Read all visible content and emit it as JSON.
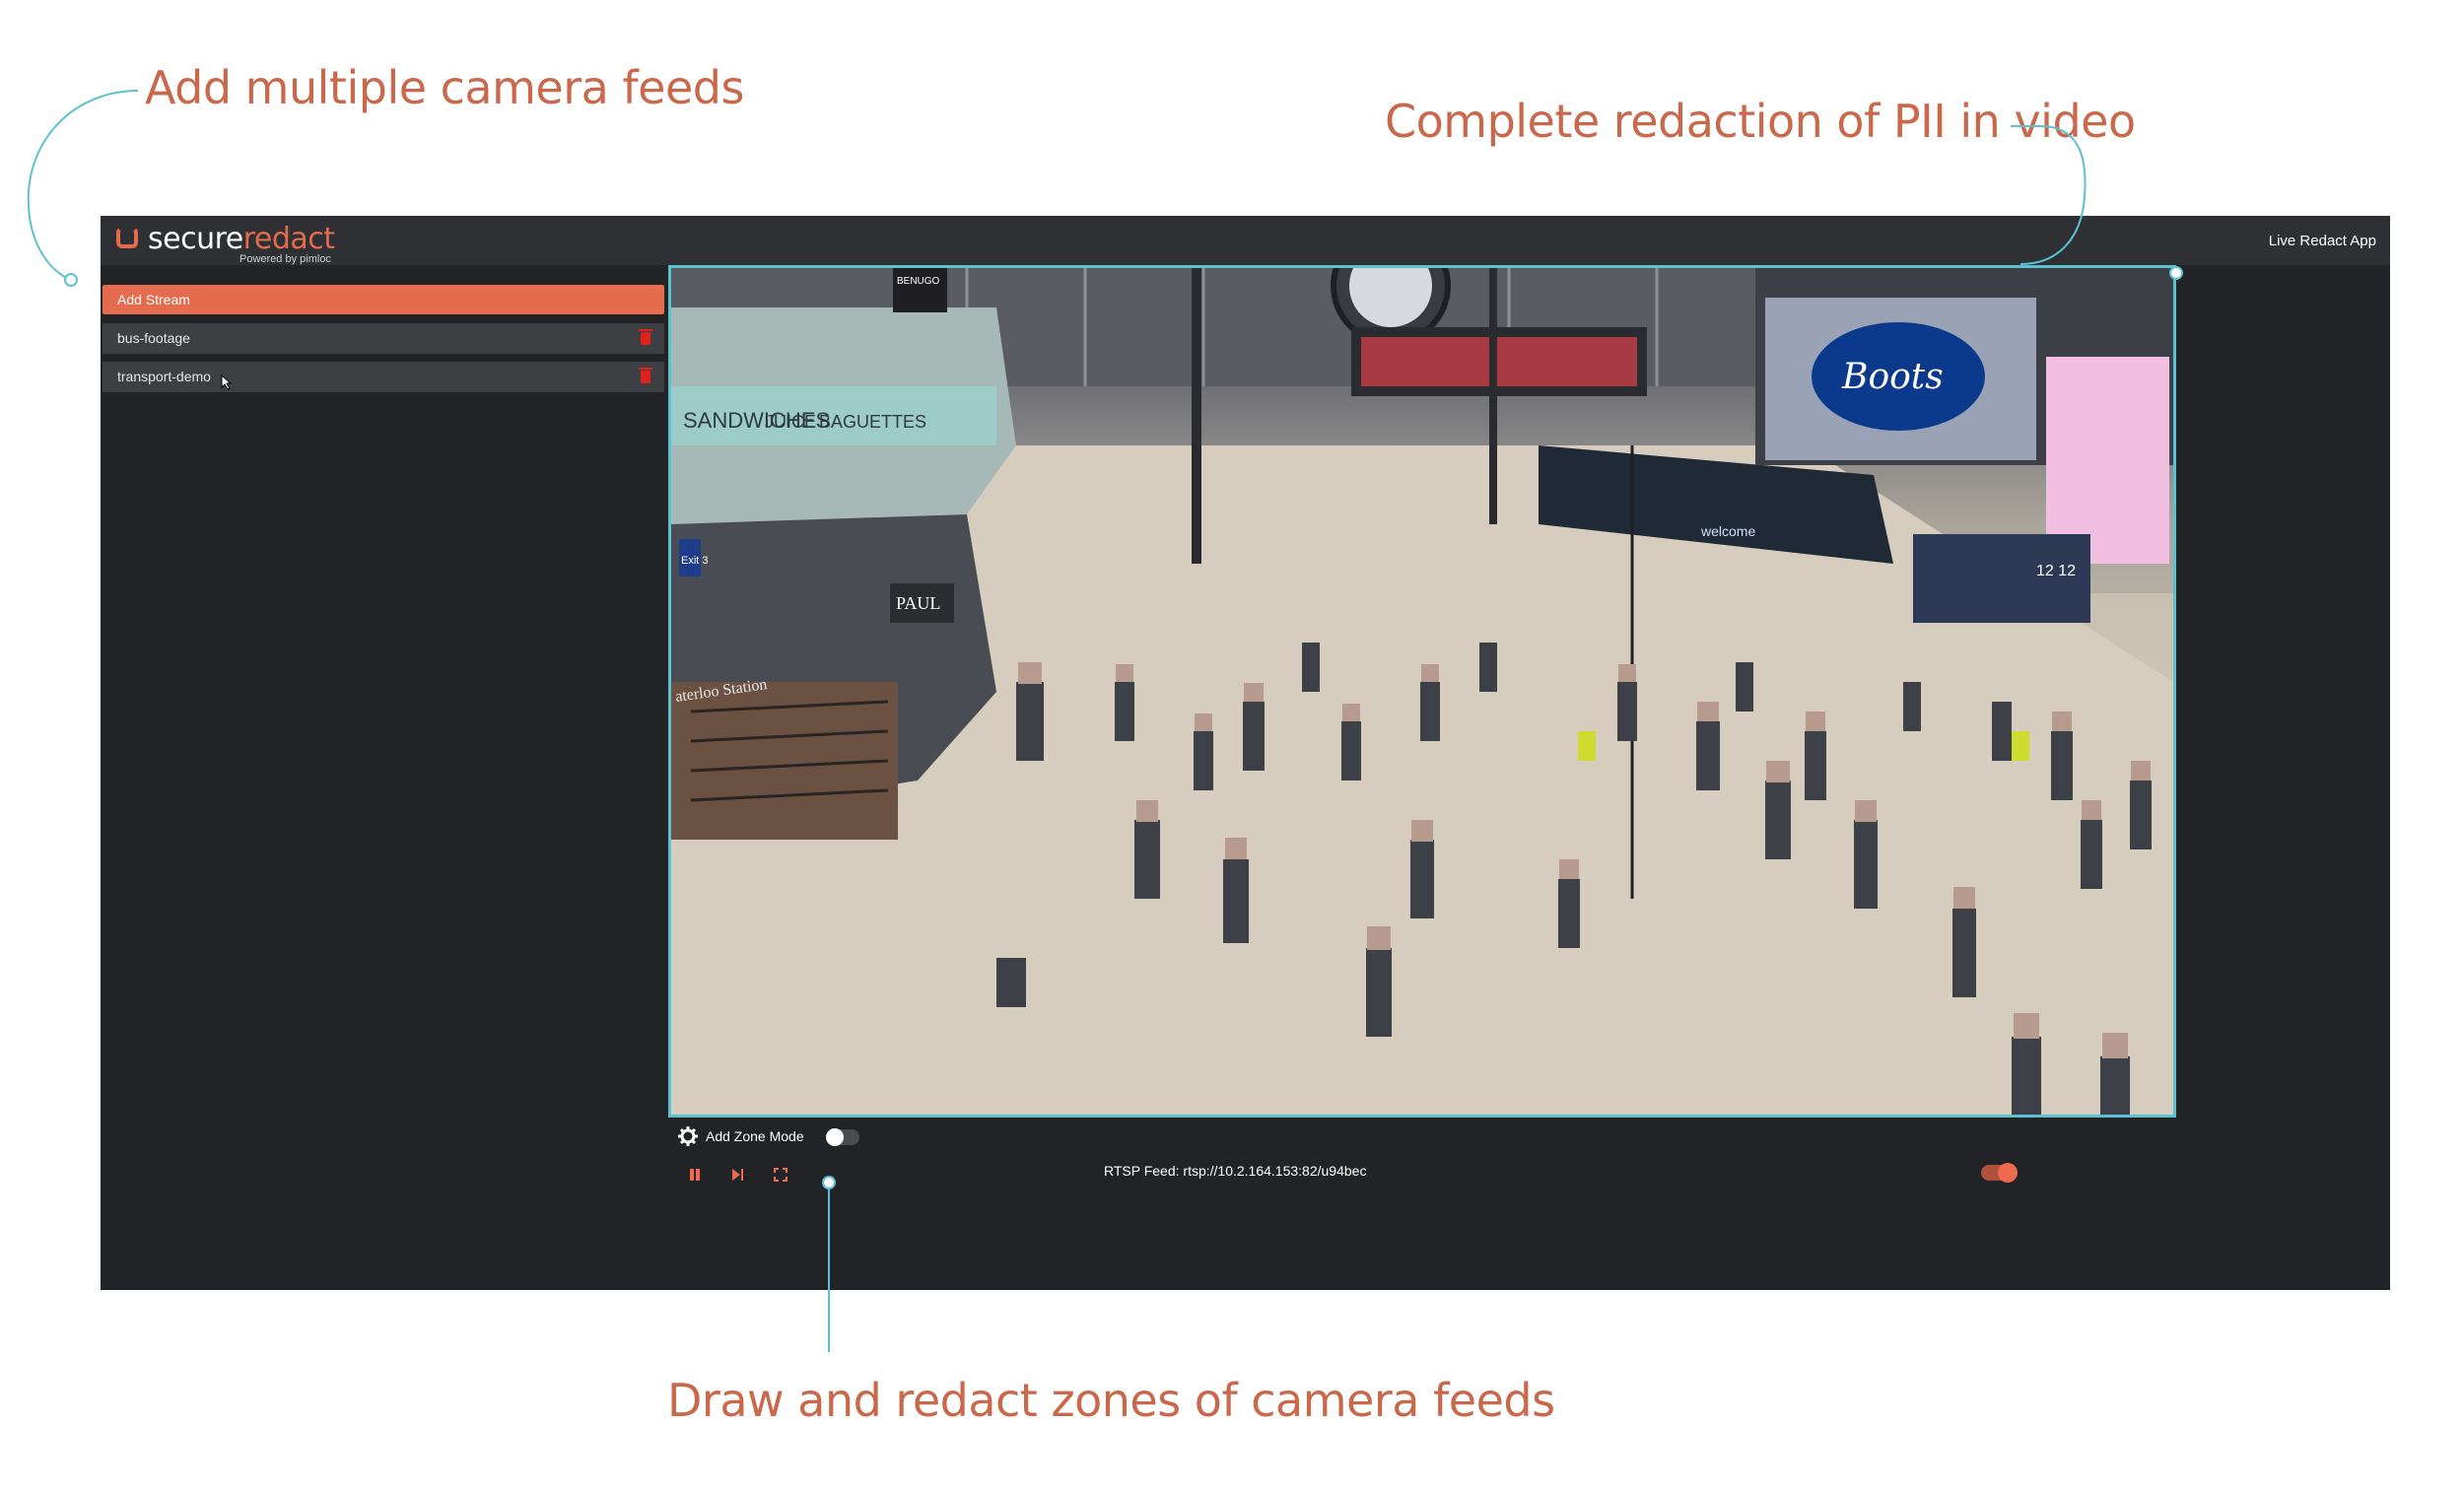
{
  "callouts": {
    "multiple_feeds": "Add multiple camera feeds",
    "redaction": "Complete redaction of PII in video",
    "zones": "Draw and redact zones of camera feeds"
  },
  "header": {
    "logo_secure": "secure",
    "logo_redact": "redact",
    "logo_sub": "Powered by pimloc",
    "app_title": "Live Redact App"
  },
  "sidebar": {
    "add_stream_label": "Add Stream",
    "streams": [
      {
        "label": "bus-footage"
      },
      {
        "label": "transport-demo"
      }
    ]
  },
  "video": {
    "signage": [
      "SANDWICHES",
      "JUICE",
      "BAGUETTES",
      "Boots",
      "Exit 3",
      "welcome",
      "12 12",
      "BENUGO",
      "PAUL",
      "aterloo Station"
    ]
  },
  "controls": {
    "add_zone_mode_label": "Add Zone Mode",
    "add_zone_mode_on": false,
    "rtsp_label": "RTSP Feed: rtsp://10.2.164.153:82/u94bec",
    "rtsp_toggle_on": true
  },
  "colors": {
    "accent": "#e56b4e",
    "callout": "#c9684a",
    "video_border": "#5cc2cf",
    "background": "#222326"
  }
}
